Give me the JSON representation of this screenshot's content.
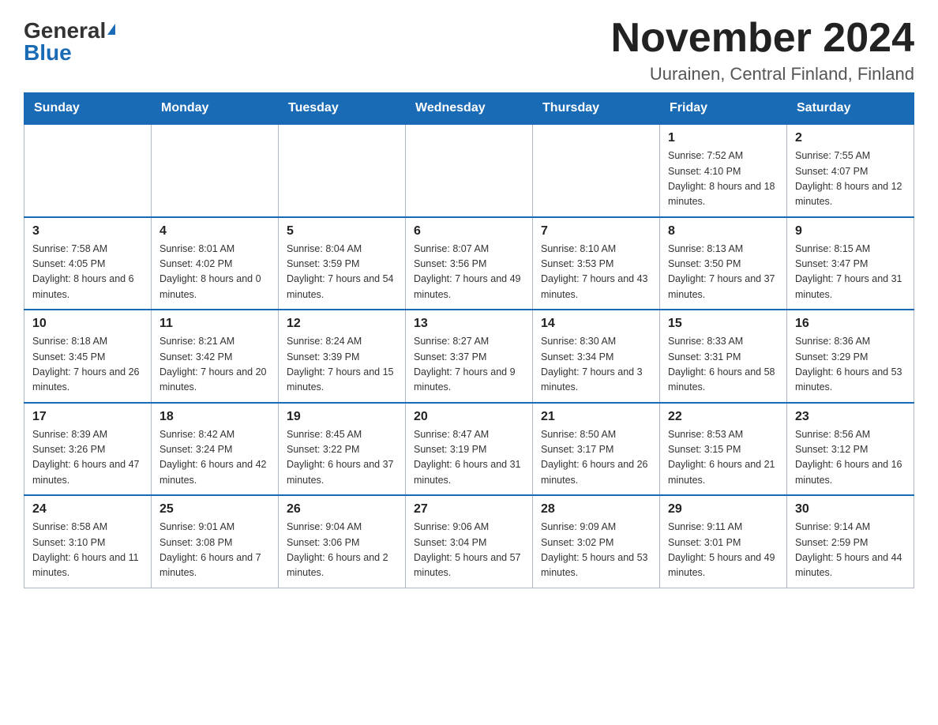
{
  "header": {
    "logo": {
      "general": "General",
      "blue": "Blue"
    },
    "month": "November 2024",
    "location": "Uurainen, Central Finland, Finland"
  },
  "weekdays": [
    "Sunday",
    "Monday",
    "Tuesday",
    "Wednesday",
    "Thursday",
    "Friday",
    "Saturday"
  ],
  "weeks": [
    [
      {
        "day": "",
        "info": ""
      },
      {
        "day": "",
        "info": ""
      },
      {
        "day": "",
        "info": ""
      },
      {
        "day": "",
        "info": ""
      },
      {
        "day": "",
        "info": ""
      },
      {
        "day": "1",
        "info": "Sunrise: 7:52 AM\nSunset: 4:10 PM\nDaylight: 8 hours\nand 18 minutes."
      },
      {
        "day": "2",
        "info": "Sunrise: 7:55 AM\nSunset: 4:07 PM\nDaylight: 8 hours\nand 12 minutes."
      }
    ],
    [
      {
        "day": "3",
        "info": "Sunrise: 7:58 AM\nSunset: 4:05 PM\nDaylight: 8 hours\nand 6 minutes."
      },
      {
        "day": "4",
        "info": "Sunrise: 8:01 AM\nSunset: 4:02 PM\nDaylight: 8 hours\nand 0 minutes."
      },
      {
        "day": "5",
        "info": "Sunrise: 8:04 AM\nSunset: 3:59 PM\nDaylight: 7 hours\nand 54 minutes."
      },
      {
        "day": "6",
        "info": "Sunrise: 8:07 AM\nSunset: 3:56 PM\nDaylight: 7 hours\nand 49 minutes."
      },
      {
        "day": "7",
        "info": "Sunrise: 8:10 AM\nSunset: 3:53 PM\nDaylight: 7 hours\nand 43 minutes."
      },
      {
        "day": "8",
        "info": "Sunrise: 8:13 AM\nSunset: 3:50 PM\nDaylight: 7 hours\nand 37 minutes."
      },
      {
        "day": "9",
        "info": "Sunrise: 8:15 AM\nSunset: 3:47 PM\nDaylight: 7 hours\nand 31 minutes."
      }
    ],
    [
      {
        "day": "10",
        "info": "Sunrise: 8:18 AM\nSunset: 3:45 PM\nDaylight: 7 hours\nand 26 minutes."
      },
      {
        "day": "11",
        "info": "Sunrise: 8:21 AM\nSunset: 3:42 PM\nDaylight: 7 hours\nand 20 minutes."
      },
      {
        "day": "12",
        "info": "Sunrise: 8:24 AM\nSunset: 3:39 PM\nDaylight: 7 hours\nand 15 minutes."
      },
      {
        "day": "13",
        "info": "Sunrise: 8:27 AM\nSunset: 3:37 PM\nDaylight: 7 hours\nand 9 minutes."
      },
      {
        "day": "14",
        "info": "Sunrise: 8:30 AM\nSunset: 3:34 PM\nDaylight: 7 hours\nand 3 minutes."
      },
      {
        "day": "15",
        "info": "Sunrise: 8:33 AM\nSunset: 3:31 PM\nDaylight: 6 hours\nand 58 minutes."
      },
      {
        "day": "16",
        "info": "Sunrise: 8:36 AM\nSunset: 3:29 PM\nDaylight: 6 hours\nand 53 minutes."
      }
    ],
    [
      {
        "day": "17",
        "info": "Sunrise: 8:39 AM\nSunset: 3:26 PM\nDaylight: 6 hours\nand 47 minutes."
      },
      {
        "day": "18",
        "info": "Sunrise: 8:42 AM\nSunset: 3:24 PM\nDaylight: 6 hours\nand 42 minutes."
      },
      {
        "day": "19",
        "info": "Sunrise: 8:45 AM\nSunset: 3:22 PM\nDaylight: 6 hours\nand 37 minutes."
      },
      {
        "day": "20",
        "info": "Sunrise: 8:47 AM\nSunset: 3:19 PM\nDaylight: 6 hours\nand 31 minutes."
      },
      {
        "day": "21",
        "info": "Sunrise: 8:50 AM\nSunset: 3:17 PM\nDaylight: 6 hours\nand 26 minutes."
      },
      {
        "day": "22",
        "info": "Sunrise: 8:53 AM\nSunset: 3:15 PM\nDaylight: 6 hours\nand 21 minutes."
      },
      {
        "day": "23",
        "info": "Sunrise: 8:56 AM\nSunset: 3:12 PM\nDaylight: 6 hours\nand 16 minutes."
      }
    ],
    [
      {
        "day": "24",
        "info": "Sunrise: 8:58 AM\nSunset: 3:10 PM\nDaylight: 6 hours\nand 11 minutes."
      },
      {
        "day": "25",
        "info": "Sunrise: 9:01 AM\nSunset: 3:08 PM\nDaylight: 6 hours\nand 7 minutes."
      },
      {
        "day": "26",
        "info": "Sunrise: 9:04 AM\nSunset: 3:06 PM\nDaylight: 6 hours\nand 2 minutes."
      },
      {
        "day": "27",
        "info": "Sunrise: 9:06 AM\nSunset: 3:04 PM\nDaylight: 5 hours\nand 57 minutes."
      },
      {
        "day": "28",
        "info": "Sunrise: 9:09 AM\nSunset: 3:02 PM\nDaylight: 5 hours\nand 53 minutes."
      },
      {
        "day": "29",
        "info": "Sunrise: 9:11 AM\nSunset: 3:01 PM\nDaylight: 5 hours\nand 49 minutes."
      },
      {
        "day": "30",
        "info": "Sunrise: 9:14 AM\nSunset: 2:59 PM\nDaylight: 5 hours\nand 44 minutes."
      }
    ]
  ]
}
